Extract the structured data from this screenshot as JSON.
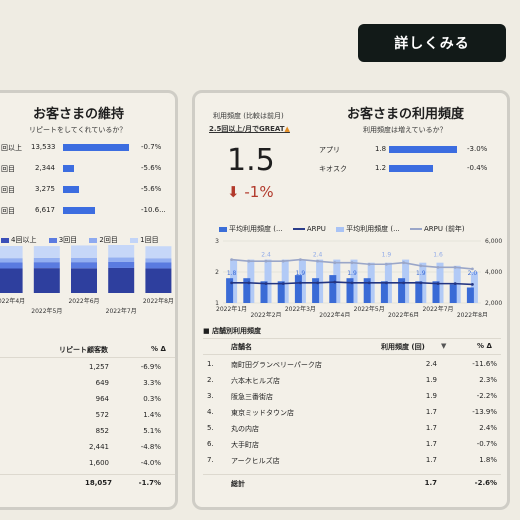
{
  "top_button": {
    "label": "詳しくみる"
  },
  "left": {
    "title": "お客さまの維持",
    "subtitle": "リピートをしてくれているか？",
    "repeat_rows": [
      {
        "label": "回以上",
        "value": "13,533",
        "change": "-0.7%",
        "frac": 1.0
      },
      {
        "label": "回目",
        "value": "2,344",
        "change": "-5.6%",
        "frac": 0.17
      },
      {
        "label": "回目",
        "value": "3,275",
        "change": "-5.6%",
        "frac": 0.24
      },
      {
        "label": "回目",
        "value": "6,617",
        "change": "-10.6...",
        "frac": 0.49
      }
    ],
    "legend": [
      "4回以上",
      "3回目",
      "2回目",
      "1回目"
    ],
    "months": [
      "2022年4月",
      "2022年5月",
      "2022年6月",
      "2022年7月",
      "2022年8月"
    ],
    "table": {
      "headers": [
        "リピート顧客数",
        "% Δ"
      ],
      "rows": [
        {
          "value": "1,257",
          "delta": "-6.9%"
        },
        {
          "value": "649",
          "delta": "3.3%"
        },
        {
          "value": "964",
          "delta": "0.3%"
        },
        {
          "value": "572",
          "delta": "1.4%"
        },
        {
          "value": "852",
          "delta": "5.1%"
        },
        {
          "value": "2,441",
          "delta": "-4.8%"
        },
        {
          "value": "1,600",
          "delta": "-4.0%"
        }
      ],
      "total": {
        "value": "18,057",
        "delta": "-1.7%"
      }
    }
  },
  "right": {
    "kpi_label": "利用頻度 (比較は前月)",
    "kpi_sublabel": "2.5回以上/月でGREAT",
    "kpi_value": "1.5",
    "kpi_change": "-1%",
    "title": "お客さまの利用頻度",
    "subtitle": "利用頻度は増えているか？",
    "channel_rows": [
      {
        "label": "アプリ",
        "value": "1.8",
        "change": "-3.0%",
        "frac": 1.0
      },
      {
        "label": "キオスク",
        "value": "1.2",
        "change": "-0.4%",
        "frac": 0.65
      }
    ],
    "legend": [
      "平均利用頻度 (...",
      "ARPU",
      "平均利用頻度 (...",
      "ARPU (前年)"
    ],
    "store_section_title": "店舗別利用頻度",
    "store_table": {
      "headers": [
        "店舗名",
        "利用頻度 (回)",
        "% Δ"
      ],
      "rows": [
        {
          "no": "1.",
          "name": "南町田グランベリーパーク店",
          "freq": "2.4",
          "delta": "-11.6%"
        },
        {
          "no": "2.",
          "name": "六本木ヒルズ店",
          "freq": "1.9",
          "delta": "2.3%"
        },
        {
          "no": "3.",
          "name": "阪急三番街店",
          "freq": "1.9",
          "delta": "-2.2%"
        },
        {
          "no": "4.",
          "name": "東京ミッドタウン店",
          "freq": "1.7",
          "delta": "-13.9%"
        },
        {
          "no": "5.",
          "name": "丸の内店",
          "freq": "1.7",
          "delta": "2.4%"
        },
        {
          "no": "6.",
          "name": "大手町店",
          "freq": "1.7",
          "delta": "-0.7%"
        },
        {
          "no": "7.",
          "name": "アークヒルズ店",
          "freq": "1.7",
          "delta": "1.8%"
        }
      ],
      "total": {
        "label": "総計",
        "freq": "1.7",
        "delta": "-2.6%"
      }
    }
  },
  "chart_data": [
    {
      "type": "bar",
      "stacked": true,
      "categories": [
        "2022年4月",
        "2022年5月",
        "2022年6月",
        "2022年7月",
        "2022年8月"
      ],
      "series": [
        {
          "name": "4回以上",
          "values": [
            13500,
            13700,
            13600,
            13800,
            13533
          ]
        },
        {
          "name": "3回目",
          "values": [
            3300,
            3300,
            3400,
            3300,
            3275
          ]
        },
        {
          "name": "2回目",
          "values": [
            2400,
            2350,
            2400,
            2450,
            2344
          ]
        },
        {
          "name": "1回目",
          "values": [
            6700,
            6500,
            6800,
            6900,
            6617
          ]
        }
      ]
    },
    {
      "type": "bar",
      "categories": [
        "2022年1月",
        "",
        "2022年2月",
        "",
        "2022年3月",
        "",
        "2022年4月",
        "",
        "2022年5月",
        "",
        "2022年6月",
        "",
        "2022年7月",
        "",
        "2022年8月"
      ],
      "series": [
        {
          "name": "平均利用頻度 (...",
          "values": [
            1.8,
            1.8,
            1.7,
            1.7,
            1.9,
            1.8,
            1.9,
            1.8,
            1.8,
            1.7,
            1.8,
            1.7,
            1.7,
            1.6,
            1.5
          ]
        },
        {
          "name": "平均利用頻度 (...",
          "values": [
            2.4,
            2.4,
            2.4,
            2.4,
            2.4,
            2.4,
            2.4,
            2.4,
            2.3,
            2.3,
            2.4,
            2.3,
            2.3,
            2.2,
            2.0
          ]
        },
        {
          "name": "ARPU",
          "values": [
            3300,
            3300,
            3250,
            3250,
            3300,
            3300,
            3350,
            3300,
            3300,
            3300,
            3300,
            3300,
            3250,
            3250,
            3200
          ]
        },
        {
          "name": "ARPU (前年)",
          "values": [
            4800,
            4700,
            4700,
            4700,
            4800,
            4700,
            4600,
            4600,
            4500,
            4500,
            4600,
            4400,
            4300,
            4300,
            4200
          ]
        }
      ],
      "ylim": [
        1,
        3
      ],
      "y2lim": [
        2000,
        6000
      ],
      "yticks": [
        "1",
        "2",
        "3"
      ],
      "y2ticks": [
        "2,000",
        "4,000",
        "6,000"
      ],
      "data_labels": [
        "1.8",
        "2.4",
        "1.9",
        "2.4",
        "1.9",
        "1.9",
        "1.9",
        "1.6",
        "2.0"
      ]
    }
  ]
}
